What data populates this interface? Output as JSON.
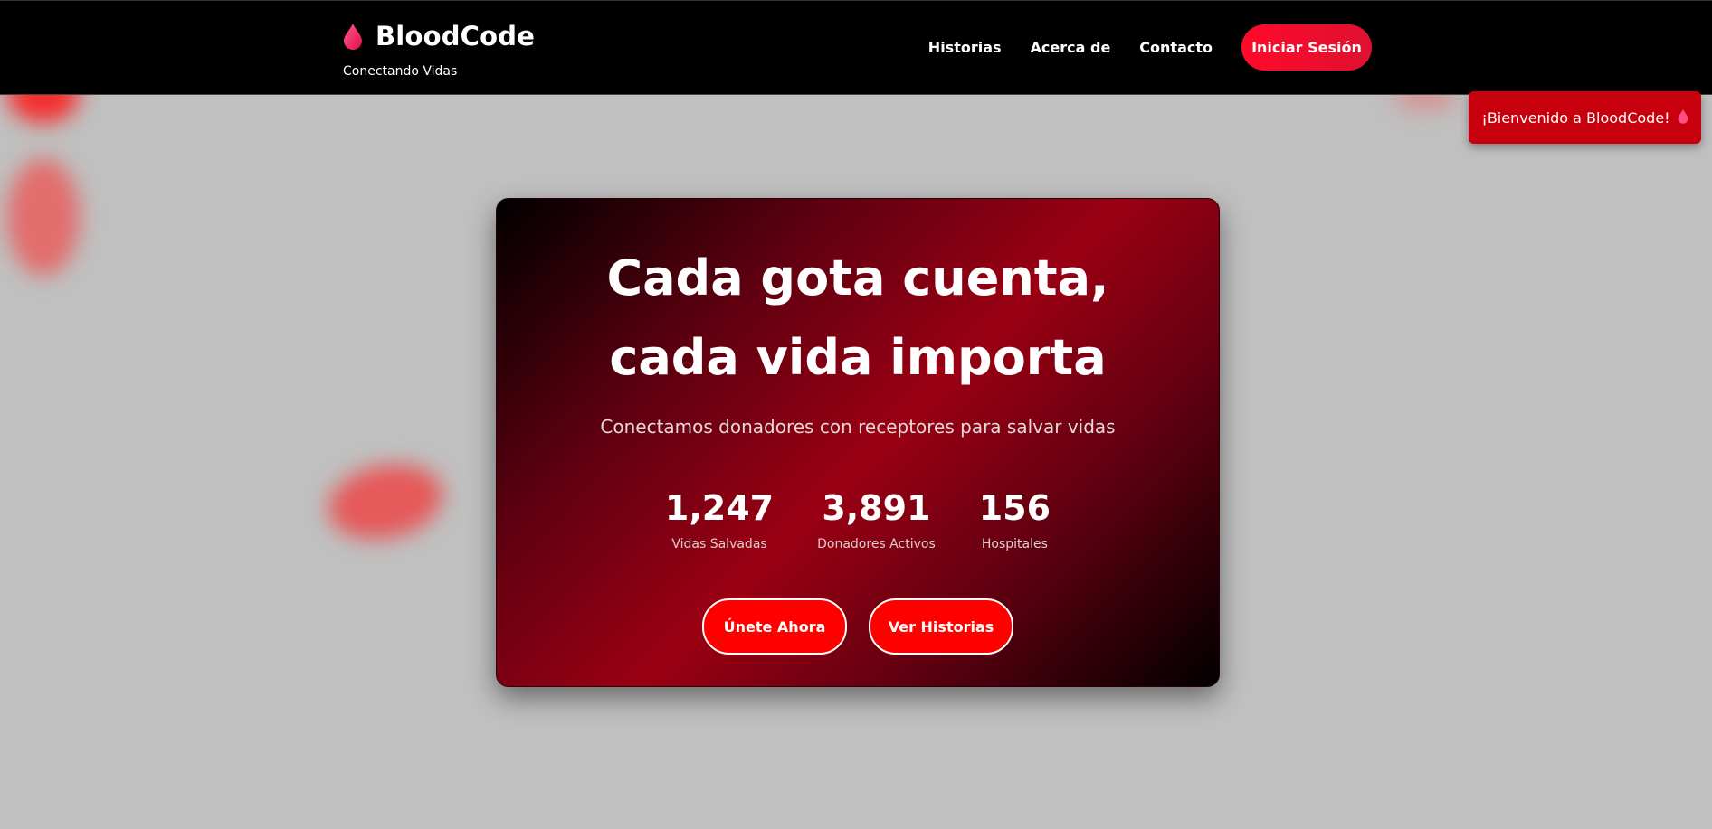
{
  "header": {
    "brand_name": "BloodCode",
    "tagline": "Conectando Vidas",
    "nav": [
      {
        "label": "Historias"
      },
      {
        "label": "Acerca de"
      },
      {
        "label": "Contacto"
      }
    ],
    "login_label": "Iniciar Sesión"
  },
  "toast": {
    "message": "¡Bienvenido a BloodCode!",
    "icon": "blood-drop-icon"
  },
  "hero": {
    "title": "Cada gota cuenta, cada vida importa",
    "subtitle": "Conectamos donadores con receptores para salvar vidas",
    "stats": [
      {
        "value": "1,247",
        "label": "Vidas Salvadas"
      },
      {
        "value": "3,891",
        "label": "Donadores Activos"
      },
      {
        "value": "156",
        "label": "Hospitales"
      }
    ],
    "buttons": {
      "join": "Únete Ahora",
      "stories": "Ver Historias"
    }
  },
  "colors": {
    "accent": "#ff0000",
    "drop": "#ff3366",
    "header_bg": "#000000",
    "page_bg": "#c0c0c0"
  }
}
